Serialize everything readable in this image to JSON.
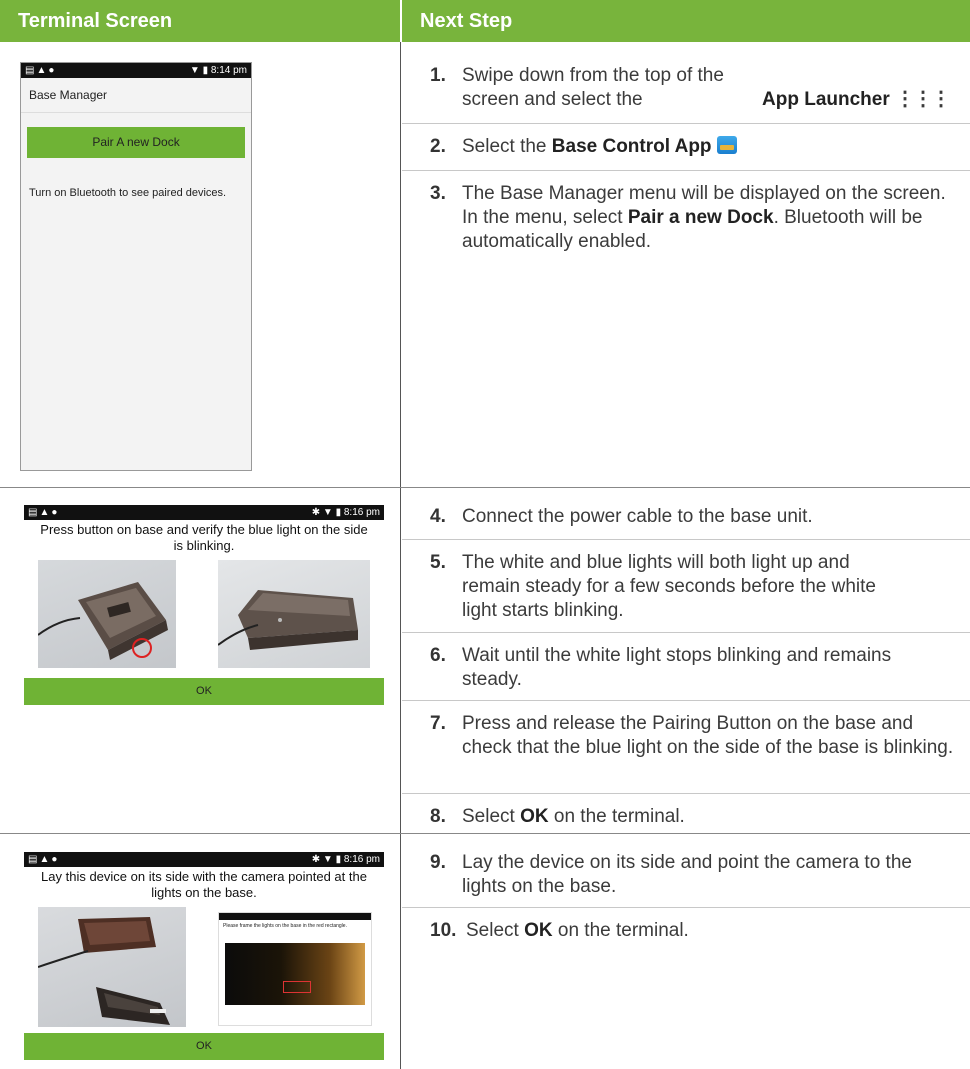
{
  "header": {
    "left": "Terminal Screen",
    "right": "Next Step"
  },
  "screen1": {
    "status_time": "8:14 pm",
    "app_title": "Base Manager",
    "pair_button": "Pair A new Dock",
    "message": "Turn on Bluetooth to see paired devices."
  },
  "screen2": {
    "status_time": "8:16 pm",
    "instruction": "Press button on base and verify the blue light on the side is blinking.",
    "ok_button": "OK"
  },
  "screen3": {
    "status_time": "8:16 pm",
    "instruction": "Lay this device on its side with the camera pointed at the lights on the base.",
    "inset_caption": "Please frame the lights on the base in the red rectangle.",
    "ok_button": "OK"
  },
  "steps": [
    {
      "num": "1.",
      "pre": "Swipe down from the top of the screen and select the ",
      "bold": "App Launcher",
      "post": ""
    },
    {
      "num": "2.",
      "pre": "Select the ",
      "bold": "Base Control App",
      "post": ""
    },
    {
      "num": "3.",
      "pre": "The Base Manager menu will be displayed on the screen. In the menu, select ",
      "bold": "Pair a new Dock",
      "post": ". Bluetooth will be automatically enabled."
    },
    {
      "num": "4.",
      "pre": "Connect the power cable to the base unit.",
      "bold": "",
      "post": ""
    },
    {
      "num": "5.",
      "pre": "The white and blue lights will both light up and remain steady for a few seconds before the white light starts blinking.",
      "bold": "",
      "post": ""
    },
    {
      "num": "6.",
      "pre": "Wait until the white light stops blinking and remains steady.",
      "bold": "",
      "post": ""
    },
    {
      "num": "7.",
      "pre": "Press and release the Pairing Button on the base and check that the blue light on the side of the base is blinking.",
      "bold": "",
      "post": ""
    },
    {
      "num": "8.",
      "pre": "Select ",
      "bold": "OK",
      "post": " on the terminal."
    },
    {
      "num": "9.",
      "pre": "Lay the device on its side and point the camera to the lights on the base.",
      "bold": "",
      "post": ""
    },
    {
      "num": "10.",
      "pre": "Select ",
      "bold": "OK",
      "post": " on the terminal."
    }
  ]
}
